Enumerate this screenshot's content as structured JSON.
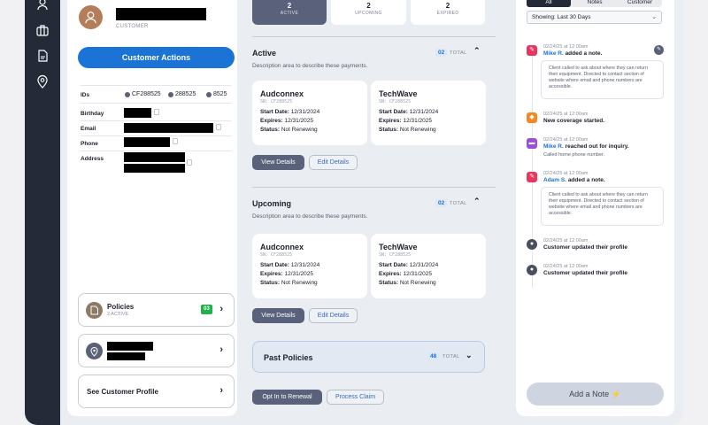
{
  "rail": {
    "icons": [
      "user-icon",
      "briefcase-icon",
      "document-icon",
      "location-icon"
    ]
  },
  "customer": {
    "role_label": "CUSTOMER",
    "actions_label": "Customer Actions",
    "ids_label": "IDs",
    "ids": [
      "CF288525",
      "288525",
      "8525"
    ],
    "fields": [
      "Birthday",
      "Email",
      "Phone",
      "Address"
    ]
  },
  "nav_cards": {
    "policies": {
      "title": "Policies",
      "sub": "2 ACTIVE",
      "count": "03"
    },
    "profile": {
      "title": "See Customer Profile"
    }
  },
  "stats": [
    {
      "num": "2",
      "label": "ACTIVE"
    },
    {
      "num": "2",
      "label": "UPCOMING"
    },
    {
      "num": "2",
      "label": "EXPIRED"
    }
  ],
  "active": {
    "title": "Active",
    "desc": "Description area to describe these payments.",
    "total": "02",
    "total_label": "TOTAL",
    "cards": [
      {
        "name": "Audconnex",
        "sn": "SN: CF288525",
        "start_label": "Start Date:",
        "start": "12/31/2024",
        "exp_label": "Expires:",
        "exp": "12/31/2025",
        "status_label": "Status:",
        "status": "Not Renewing"
      },
      {
        "name": "TechWave",
        "sn": "SN: CF288525",
        "start_label": "Start Date:",
        "start": "12/31/2024",
        "exp_label": "Expires:",
        "exp": "12/31/2025",
        "status_label": "Status:",
        "status": "Not Renewing"
      }
    ],
    "view_label": "View Details",
    "edit_label": "Edit Details"
  },
  "upcoming": {
    "title": "Upcoming",
    "desc": "Description area to describe these payments.",
    "total": "02",
    "total_label": "TOTAL",
    "cards": [
      {
        "name": "Audconnex",
        "sn": "SN: CF288525",
        "start_label": "Start Date:",
        "start": "12/31/2024",
        "exp_label": "Expires:",
        "exp": "12/31/2025",
        "status_label": "Status:",
        "status": "Not Renewing"
      },
      {
        "name": "TechWave",
        "sn": "SN: CF288525",
        "start_label": "Start Date:",
        "start": "12/31/2024",
        "exp_label": "Expires:",
        "exp": "12/31/2025",
        "status_label": "Status:",
        "status": "Not Renewing"
      }
    ],
    "view_label": "View Details",
    "edit_label": "Edit Details"
  },
  "past": {
    "title": "Past Policies",
    "total": "48",
    "total_label": "TOTAL"
  },
  "footer_actions": {
    "renewal": "Opt In to Renewal",
    "claim": "Process Claim"
  },
  "activity": {
    "tabs": [
      "All",
      "Notes",
      "Customer"
    ],
    "filter": "Showing: Last 30 Days",
    "items": [
      {
        "time": "02/24/25 at 12:00am",
        "who": "Mike R.",
        "text": " added a note.",
        "note": "Client called to ask about where they can return their equipment. Directed to contact section of website where email and phone numbers are accessible.",
        "color": "#e8365d"
      },
      {
        "time": "02/24/25 at 12:00am",
        "text": "New coverage started.",
        "color": "#f38a1f"
      },
      {
        "time": "02/24/25 at 12:00am",
        "who": "Mike R.",
        "text": " reached out for inquiry.",
        "sub": "Called home phone number.",
        "color": "#9b4fd8"
      },
      {
        "time": "02/24/25 at 12:00am",
        "who": "Adam S.",
        "text": " added a note.",
        "note": "Client called to ask about where they can return their equipment. Directed to contact section of website where email and phone numbers are accessible.",
        "color": "#e8365d"
      },
      {
        "time": "02/24/25 at 12:00am",
        "text": "Customer updated their profile",
        "color": "#4a4f5c"
      },
      {
        "time": "02/24/25 at 12:00am",
        "text": "Customer updated their profile",
        "color": "#4a4f5c"
      }
    ],
    "add_note_label": "Add a Note"
  }
}
